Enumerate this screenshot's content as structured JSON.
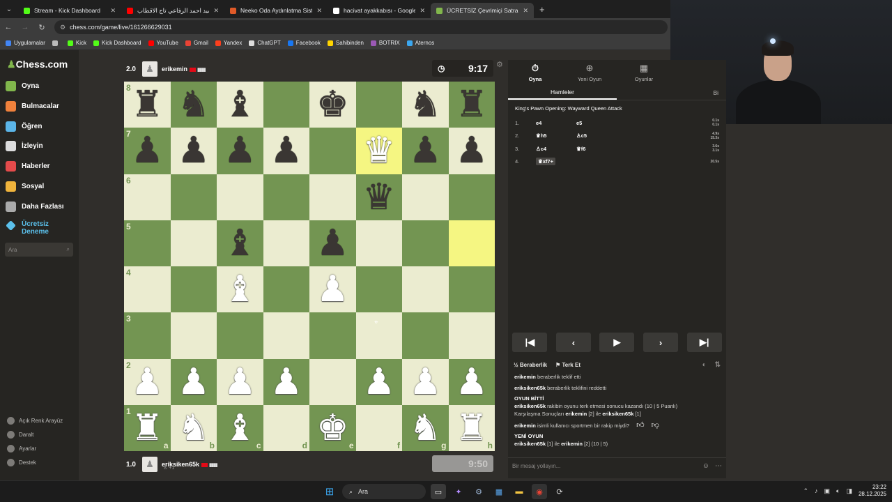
{
  "browser": {
    "tabs": [
      {
        "title": "Stream - Kick Dashboard",
        "color": "#53fc18",
        "active": false
      },
      {
        "title": "سيد احمد الرفاعي تاج الاقطاب",
        "color": "#ff0000",
        "active": false
      },
      {
        "title": "Neeko Oda Aydınlatma Sistemi",
        "color": "#e05a28",
        "active": false
      },
      {
        "title": "hacivat ayakkabısı - Google'da",
        "color": "#ffffff",
        "active": false
      },
      {
        "title": "ÜCRETSİZ Çevrimiçi Satranç Oy",
        "color": "#81b64c",
        "active": true
      }
    ],
    "url": "chess.com/game/live/161266629031",
    "bookmarks": [
      {
        "label": "Uygulamalar",
        "color": "#4285f4"
      },
      {
        "label": "",
        "color": "#bbbbbb"
      },
      {
        "label": "Kick",
        "color": "#53fc18"
      },
      {
        "label": "Kick Dashboard",
        "color": "#53fc18"
      },
      {
        "label": "YouTube",
        "color": "#ff0000"
      },
      {
        "label": "Gmail",
        "color": "#ea4335"
      },
      {
        "label": "Yandex",
        "color": "#fc3f1d"
      },
      {
        "label": "ChatGPT",
        "color": "#dddddd"
      },
      {
        "label": "Facebook",
        "color": "#1877f2"
      },
      {
        "label": "Sahibinden",
        "color": "#ffd400"
      },
      {
        "label": "BOTRIX",
        "color": "#9b59b6"
      },
      {
        "label": "Aternos",
        "color": "#3ba7f0"
      }
    ]
  },
  "sidebar": {
    "logo": "Chess.com",
    "items": [
      {
        "label": "Oyna",
        "color": "#81b64c"
      },
      {
        "label": "Bulmacalar",
        "color": "#f0813c"
      },
      {
        "label": "Öğren",
        "color": "#5bb5e8"
      },
      {
        "label": "İzleyin",
        "color": "#dddddd"
      },
      {
        "label": "Haberler",
        "color": "#e44b4b"
      },
      {
        "label": "Sosyal",
        "color": "#f0b43c"
      },
      {
        "label": "Daha Fazlası",
        "color": "#aaaaaa"
      }
    ],
    "trial": "Ücretsiz Deneme",
    "search_placeholder": "Ara",
    "bottom": [
      "Açık Renk Arayüz",
      "Daralt",
      "Ayarlar",
      "Destek"
    ]
  },
  "game": {
    "top_player": {
      "rating": "2.0",
      "name": "erikemin",
      "bars": "▮▮▮▮"
    },
    "bottom_player": {
      "rating": "1.0",
      "name": "eriksiken65k",
      "bars": "▮▮▮▮",
      "captured": "+1"
    },
    "top_clock": "9:17",
    "bottom_clock": "9:50",
    "board": [
      [
        "br",
        "bn",
        "bb",
        "",
        "bk",
        "",
        "bn",
        "br"
      ],
      [
        "bp",
        "bp",
        "bp",
        "bp",
        "",
        "wq",
        "bp",
        "bp"
      ],
      [
        "",
        "",
        "",
        "",
        "",
        "bq",
        "",
        ""
      ],
      [
        "",
        "",
        "bb",
        "",
        "bp",
        "",
        "",
        ""
      ],
      [
        "",
        "",
        "wb",
        "",
        "wp",
        "",
        "",
        ""
      ],
      [
        "",
        "",
        "",
        "",
        "",
        "",
        "",
        ""
      ],
      [
        "wp",
        "wp",
        "wp",
        "wp",
        "",
        "wp",
        "wp",
        "wp"
      ],
      [
        "wr",
        "wn",
        "wb",
        "",
        "wk",
        "",
        "wn",
        "wr"
      ]
    ],
    "highlights": [
      "f7",
      "h5"
    ],
    "ranks": [
      "8",
      "7",
      "6",
      "5",
      "4",
      "3",
      "2",
      "1"
    ],
    "files": [
      "a",
      "b",
      "c",
      "d",
      "e",
      "f",
      "g",
      "h"
    ]
  },
  "panel": {
    "tabs": [
      {
        "label": "Oyna",
        "icon": "stopwatch-icon"
      },
      {
        "label": "Yeni Oyun",
        "icon": "plus-icon"
      },
      {
        "label": "Oyunlar",
        "icon": "board-icon"
      }
    ],
    "subtabs": [
      "Hamleler",
      "Bi"
    ],
    "opening": "King's Pawn Opening: Wayward Queen Attack",
    "moves": [
      {
        "num": "1.",
        "white": "e4",
        "black": "e5",
        "time": "0.1s\n0.1s"
      },
      {
        "num": "2.",
        "white": "♛h5",
        "black": "♙c5",
        "time": "4.9s\n15.3s"
      },
      {
        "num": "3.",
        "white": "♙c4",
        "black": "♛f6",
        "time": "3.6s\n3.1s"
      },
      {
        "num": "4.",
        "white": "♛xf7+",
        "black": "",
        "time": "20.5s"
      }
    ],
    "actions": {
      "draw": "Beraberlik",
      "resign": "Terk Et"
    },
    "chat": {
      "line1_user": "erikemin",
      "line1_text": " beraberlik teklif etti",
      "line2_user": "eriksiken65k",
      "line2_text": " beraberlik teklifini reddetti",
      "game_over": "OYUN BİTTİ",
      "result_user": "eriksiken65k",
      "result_text": " rakibin oyunu terk etmesi sonucu kazandı (10 | 5 Puanlı)",
      "h2h_prefix": "Karşılaşma Sonuçları ",
      "h2h_p1": "erikemin",
      "h2h_mid": " [2] ile ",
      "h2h_p2": "eriksiken65k",
      "h2h_suffix": " [1]",
      "feedback_user": "erikemin",
      "feedback_text": " isimli kullanıcı sportmen bir rakip miydi?",
      "new_game": "YENİ OYUN",
      "ng_p1": "eriksiken65k",
      "ng_mid": " [1] ile ",
      "ng_p2": "erikemin",
      "ng_suffix": " [2] (10 | 5)"
    },
    "message_placeholder": "Bir mesaj yollayın..."
  },
  "taskbar": {
    "search": "Ara",
    "time": "23:22",
    "date": "28.12.2025"
  }
}
